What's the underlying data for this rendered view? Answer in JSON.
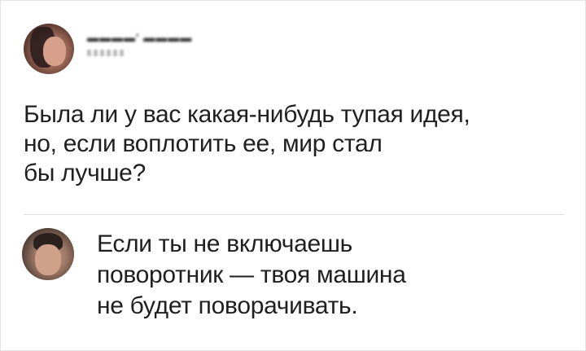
{
  "post": {
    "avatar_icon": "user-avatar",
    "text": "Была ли у вас какая-нибудь тупая идея,\nно, если воплотить ее, мир стал\nбы лучше?"
  },
  "comment": {
    "avatar_icon": "user-avatar",
    "text": "Если ты не включаешь\nповоротник — твоя машина\nне будет поворачивать."
  }
}
